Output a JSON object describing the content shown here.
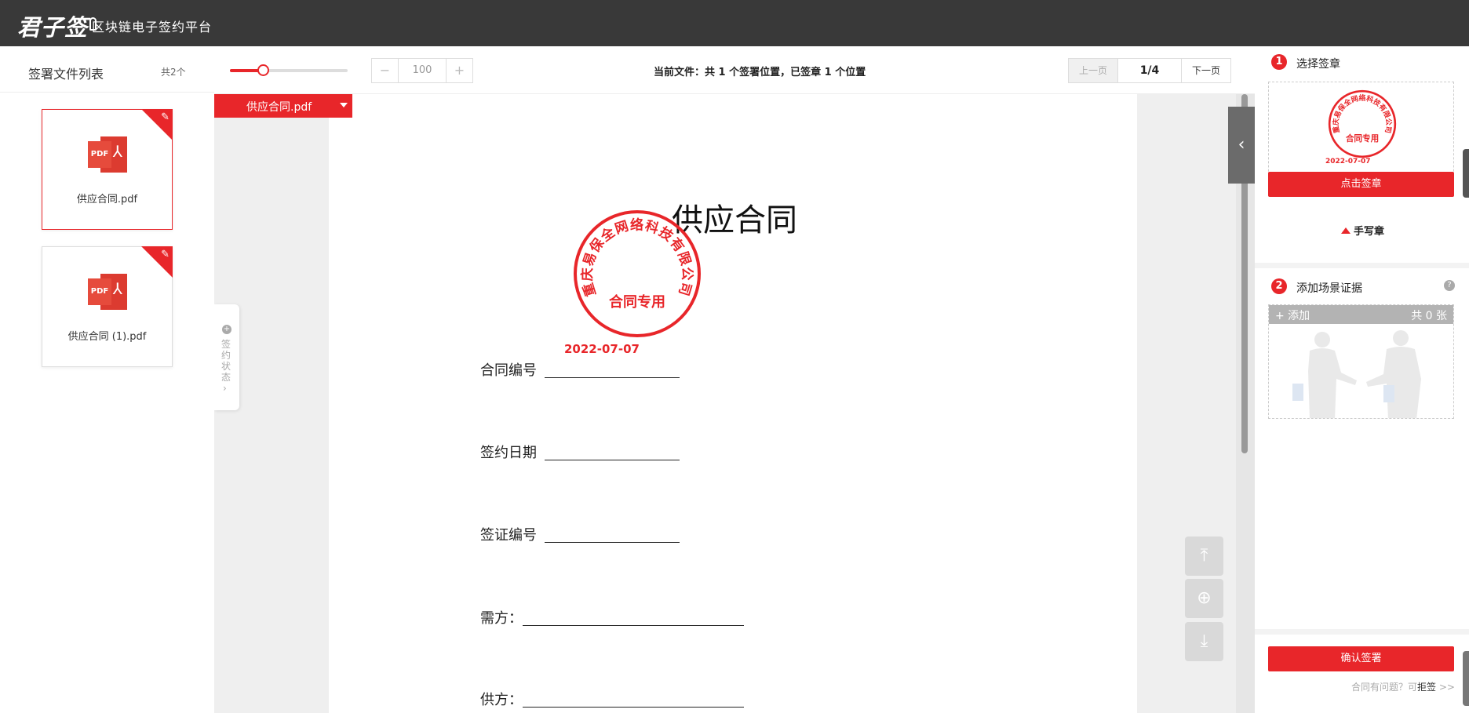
{
  "header": {
    "logo_text": "君子签",
    "platform_name": "区块链电子签约平台"
  },
  "left_panel": {
    "title": "签署文件列表",
    "count": "共2个",
    "files": [
      {
        "name": "供应合同.pdf",
        "icon": "pdf-file-icon",
        "active": true
      },
      {
        "name": "供应合同 (1).pdf",
        "icon": "pdf-file-icon",
        "active": false
      }
    ]
  },
  "toolbar": {
    "zoom_value": "100",
    "zoom_minus": "−",
    "zoom_plus": "+",
    "zoom_slider_level": 0.28,
    "current_file_status": "当前文件：共 1 个签署位置，已签章 1 个位置",
    "prev_label": "上一页",
    "page_indicator": "1/4",
    "next_label": "下一页"
  },
  "viewer": {
    "file_tab_label": "供应合同.pdf",
    "status_tab_label": "签约状态",
    "document": {
      "title": "供应合同",
      "seal_company": "重庆易保全网络科技有限公司",
      "seal_label": "合同专用",
      "seal_date": "2022-07-07",
      "fields": [
        {
          "label": "合同编号"
        },
        {
          "label": "签约日期"
        },
        {
          "label": "签证编号"
        },
        {
          "label": "需方："
        },
        {
          "label": "供方："
        }
      ]
    },
    "nav_icons": [
      "to-top-icon",
      "locate-icon",
      "to-bottom-icon"
    ]
  },
  "right_panel": {
    "step1": {
      "num": "1",
      "title": "选择签章"
    },
    "seal_preview_date": "2022-07-07",
    "apply_seal_button": "点击签章",
    "handwrite_label": "手写章",
    "step2": {
      "num": "2",
      "title": "添加场景证据"
    },
    "help_icon": "?",
    "evidence_add": "+ 添加",
    "evidence_count": "共 0 张",
    "confirm_button": "确认签署",
    "legal_prefix": "合同有问题？可",
    "legal_reject": "拒签",
    "legal_suffix": " >>"
  },
  "colors": {
    "brand_red": "#e8262a",
    "header_bg": "#393939"
  }
}
